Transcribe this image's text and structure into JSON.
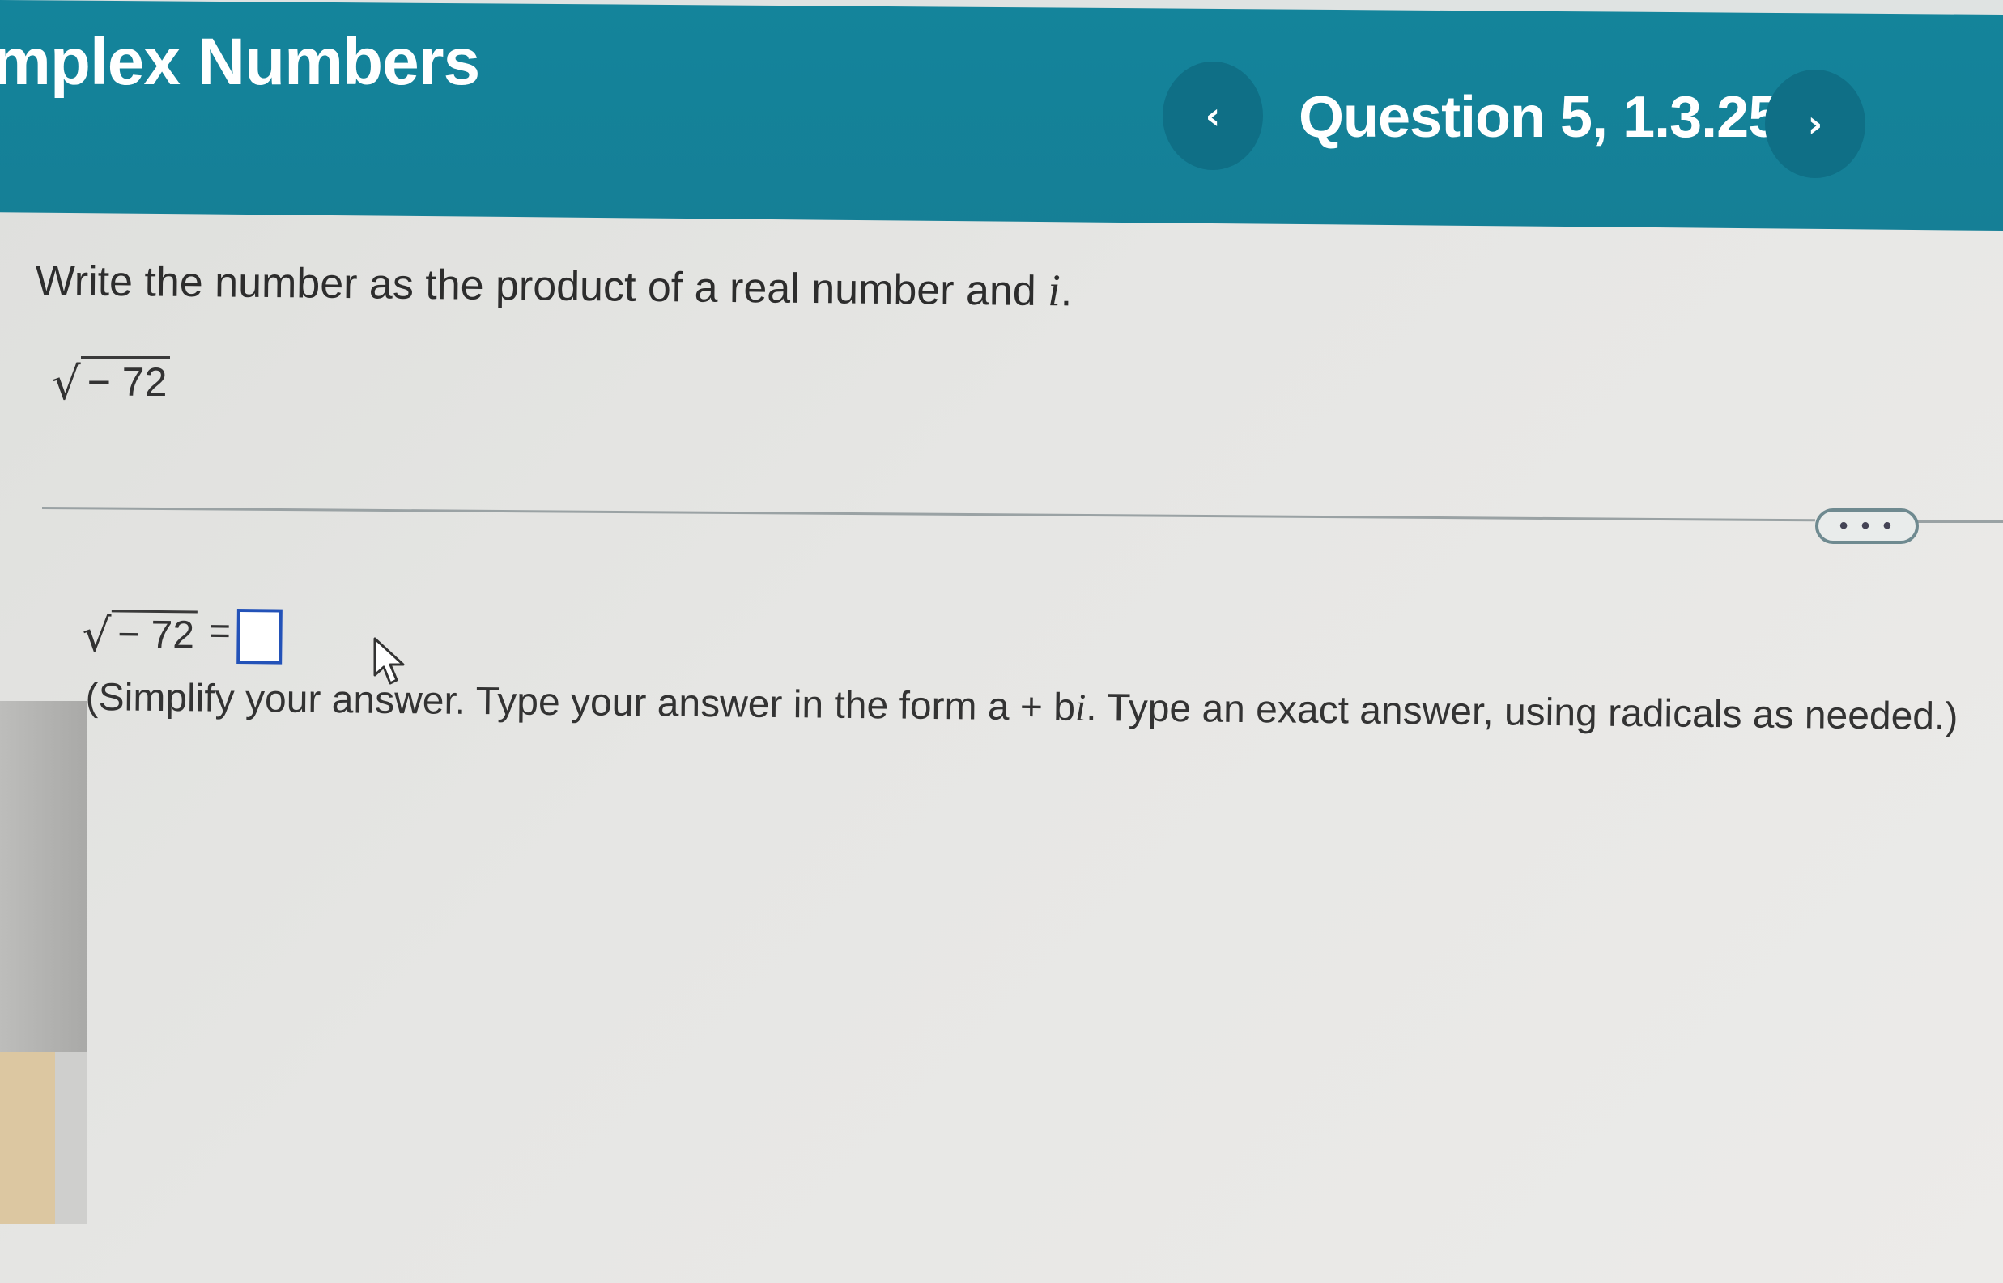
{
  "header": {
    "section_title": "mplex Numbers",
    "question_label": "Question 5, 1.3.25",
    "prev_symbol": "‹",
    "next_symbol": "›",
    "bg_color": "#157f96"
  },
  "question": {
    "instruction_text": "Write the number as the product of a real number and ",
    "instruction_var": "i",
    "instruction_end": ".",
    "expression": "− 72"
  },
  "more_button": {
    "label": "• • •"
  },
  "answer": {
    "lhs": "− 72",
    "equals": "=",
    "value": "",
    "note_part1": "(Simplify your answer. Type your answer in the form a + b",
    "note_var": "i",
    "note_part2": ". Type an exact answer, using radicals as needed.)"
  },
  "icons": {
    "radical": "√",
    "cursor": "mouse-pointer-icon"
  }
}
